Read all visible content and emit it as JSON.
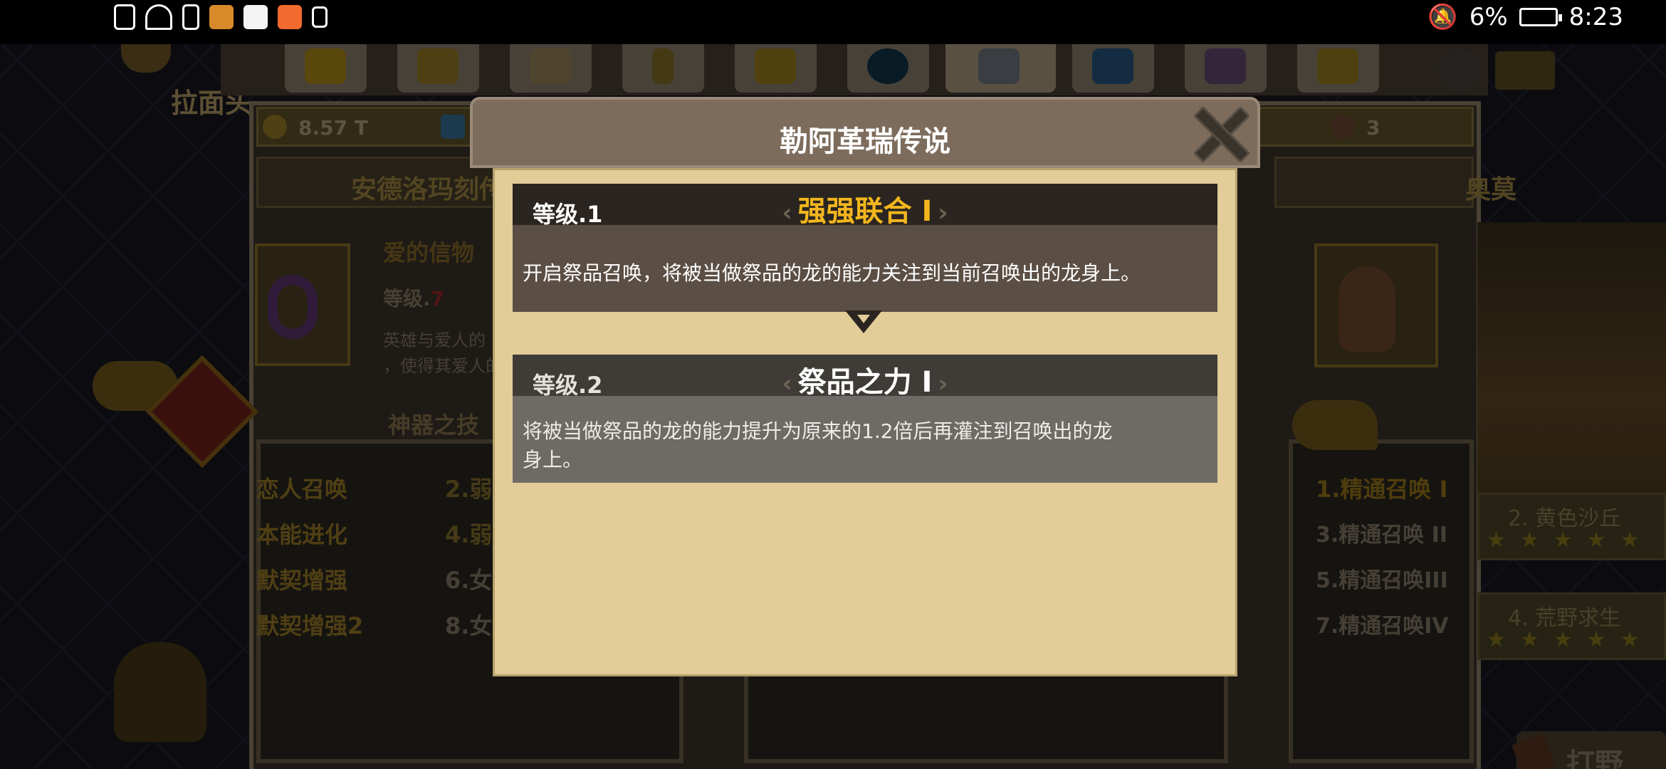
{
  "status_bar": {
    "battery_percent": "6%",
    "time": "8:23"
  },
  "background": {
    "left_title": "拉面头",
    "resources": {
      "gold": "8.57 T",
      "badge_count": "3"
    },
    "left_header": "安德洛玛刻传",
    "right_header": "奥莫",
    "artifact": {
      "name": "爱的信物",
      "level_label": "等级.",
      "level_value": "7",
      "desc_line1": "英雄与爱人的",
      "desc_line2": "，使得其爱人的"
    },
    "skill_section_title": "神器之技",
    "left_skills": [
      "恋人召唤",
      "本能进化",
      "默契增强",
      "默契增强2"
    ],
    "left_skills_col2": [
      "2.弱",
      "4.弱",
      "6.女",
      "8.女"
    ],
    "right_skills": [
      "1.精通召唤 I",
      "3.精通召唤 II",
      "5.精通召唤III",
      "7.精通召唤IV"
    ],
    "terrain_skills": [
      "2. 黄色沙丘",
      "4. 荒野求生"
    ],
    "farm_button": "打野"
  },
  "dialog": {
    "title": "勒阿革瑞传说",
    "levels": [
      {
        "label": "等级.1",
        "name": "强强联合 I",
        "description": "开启祭品召唤，将被当做祭品的龙的能力关注到当前召唤出的龙身上。",
        "state": "active",
        "name_color": "#f3b61d"
      },
      {
        "label": "等级.2",
        "name": "祭品之力 I",
        "description_line1": "将被当做祭品的龙的能力提升为原来的1.2倍后再灌注到召唤出的龙",
        "description_line2": "身上。",
        "state": "locked",
        "name_color": "#ffffff"
      }
    ]
  },
  "colors": {
    "dialog_body": "#e2cc98",
    "active_card": "#5b4e44",
    "locked_card": "#6e6a66",
    "gold_text": "#f3b61d"
  }
}
